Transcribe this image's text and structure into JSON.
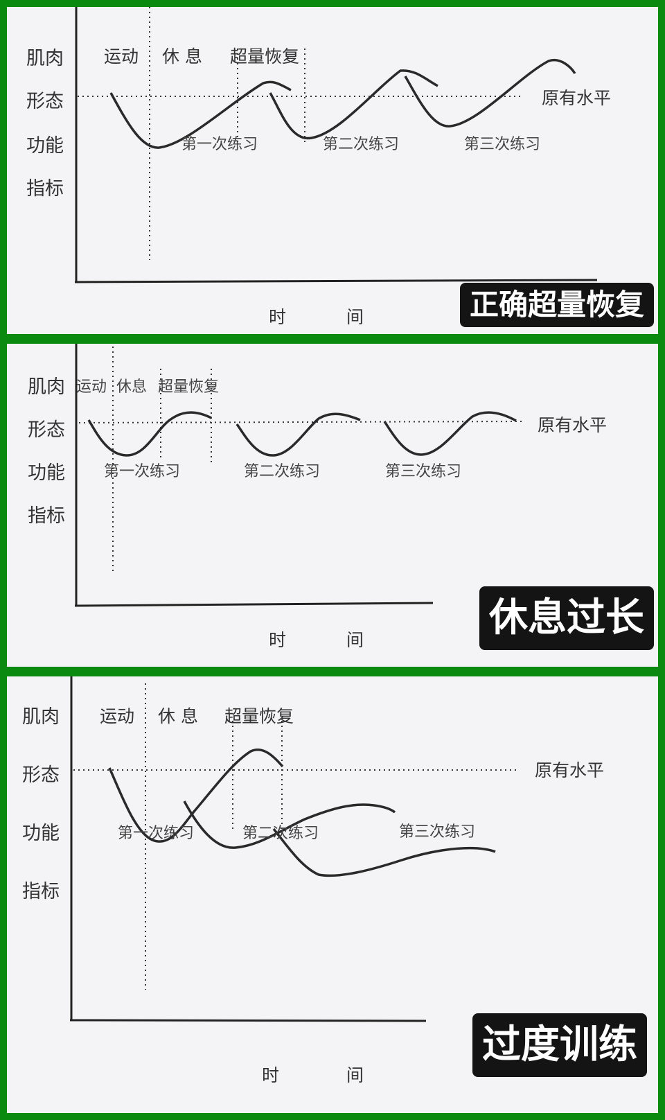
{
  "panels": [
    {
      "caption": "正确超量恢复",
      "y_axis_label": [
        "肌肉",
        "形态",
        "功能",
        "指标"
      ],
      "x_axis_label": [
        "时",
        "间"
      ],
      "phases": [
        "运动",
        "休 息",
        "超量恢复"
      ],
      "baseline_label": "原有水平",
      "sessions": [
        "第一次练习",
        "第二次练习",
        "第三次练习"
      ]
    },
    {
      "caption": "休息过长",
      "y_axis_label": [
        "肌肉",
        "形态",
        "功能",
        "指标"
      ],
      "x_axis_label": [
        "时",
        "间"
      ],
      "phases": [
        "运动",
        "休息",
        "超量恢复"
      ],
      "baseline_label": "原有水平",
      "sessions": [
        "第一次练习",
        "第二次练习",
        "第三次练习"
      ]
    },
    {
      "caption": "过度训练",
      "y_axis_label": [
        "肌肉",
        "形态",
        "功能",
        "指标"
      ],
      "x_axis_label": [
        "时",
        "间"
      ],
      "phases": [
        "运动",
        "休 息",
        "超量恢复"
      ],
      "baseline_label": "原有水平",
      "sessions": [
        "第一次练习",
        "第二次练习",
        "第三次练习"
      ]
    }
  ],
  "colors": {
    "border": "#0a8a0f",
    "panel_bg": "#f4f4f6",
    "ink": "#333333",
    "badge_bg": "#141414",
    "badge_text": "#ffffff"
  }
}
